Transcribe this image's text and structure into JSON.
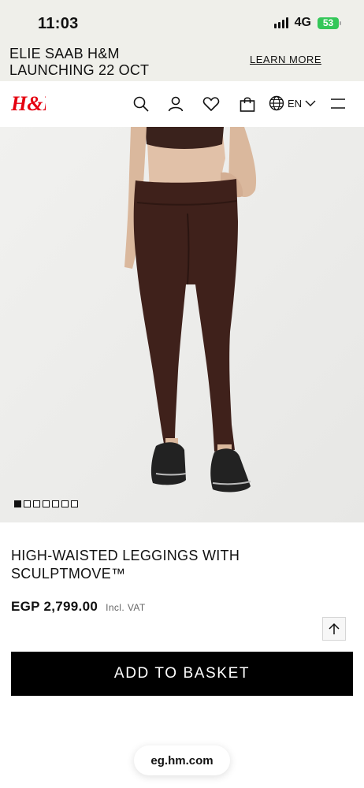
{
  "status_bar": {
    "time": "11:03",
    "network": "4G",
    "battery": "53"
  },
  "promo": {
    "text": "ELIE SAAB H&M\nLAUNCHING 22 OCT",
    "link": "LEARN MORE"
  },
  "header": {
    "logo": "H&M",
    "icons": [
      "search-icon",
      "account-icon",
      "heart-icon",
      "basket-icon",
      "globe-icon",
      "menu-icon"
    ],
    "language": "EN"
  },
  "gallery": {
    "image_count": 7,
    "active_index": 0
  },
  "product": {
    "title": "HIGH-WAISTED LEGGINGS WITH SCULPTMOVE™",
    "price": "EGP 2,799.00",
    "vat_note": "Incl. VAT"
  },
  "actions": {
    "add_to_basket": "ADD TO BASKET"
  },
  "browser": {
    "url": "eg.hm.com"
  },
  "colors": {
    "brand_red": "#e50010",
    "banner_bg": "#efefea",
    "button_bg": "#000000",
    "battery_green": "#34c759"
  }
}
